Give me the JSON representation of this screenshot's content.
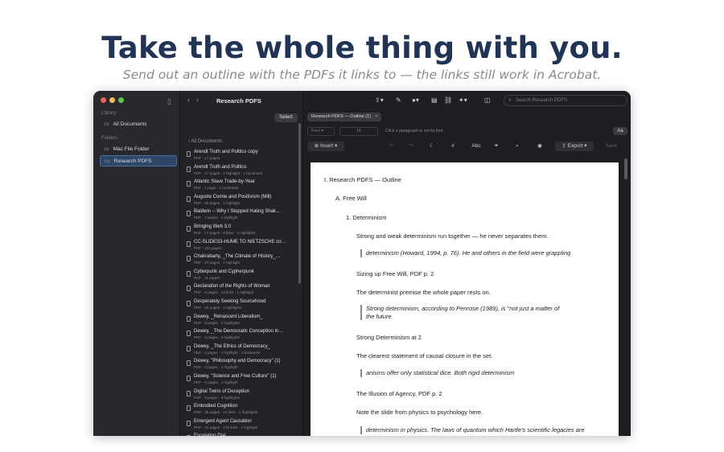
{
  "hero": {
    "title": "Take the whole thing with you.",
    "subtitle": "Send out an outline with the PDFs it links to — the links still work in Acrobat."
  },
  "colors": {
    "accent": "#2f4667",
    "hero_title": "#1f3457",
    "traffic_red": "#ee5f57",
    "traffic_yellow": "#f6be4f",
    "traffic_green": "#5fc650"
  },
  "sidebar": {
    "library_label": "Library",
    "all_documents": "All Documents",
    "folders_label": "Folders",
    "folders": [
      {
        "label": "Mac File Folder",
        "active": false
      },
      {
        "label": "Research PDFS",
        "active": true
      }
    ]
  },
  "list": {
    "title": "Research PDFS",
    "select_label": "Select",
    "back_label": "All Documents",
    "docs": [
      {
        "title": "Arendt Truth and Politics copy",
        "meta": "PDF · 17 pages"
      },
      {
        "title": "Arendt Truth and Politics",
        "meta": "PDF · 17 pages · 1 highlight · 1 bookmark"
      },
      {
        "title": "Atlantic Slave Trade-by-Year",
        "meta": "PDF · 1 page · 1 bookmark"
      },
      {
        "title": "Auguste Comte and Positivism (Mill)",
        "meta": "PDF · 65 pages · 1 highlight"
      },
      {
        "title": "Baldwin -- Why I Stopped Hating Shak…",
        "meta": "PDF · 7 pages · 1 highlight"
      },
      {
        "title": "Bringing Web 3.0",
        "meta": "PDF · 17 pages · 9 links · 2 highlights"
      },
      {
        "title": "CC-SLIDES3-HUME TO NIETZSCHE co…",
        "meta": "PDF · 115 pages"
      },
      {
        "title": "Chakrabarty, _The Climate of History_…",
        "meta": "PDF · 27 pages · 1 highlight"
      },
      {
        "title": "Cyberpunk and Cypherpunk",
        "meta": "PDF · 11 pages"
      },
      {
        "title": "Declaration of the Rights of Woman",
        "meta": "PDF · 8 pages · 13 links · 1 highlight"
      },
      {
        "title": "Desperately Seeking Sourcehood",
        "meta": "PDF · 24 pages · 2 highlights"
      },
      {
        "title": "Dewey, _Renascent Liberalism_",
        "meta": "PDF · 8 pages · 2 highlights"
      },
      {
        "title": "Dewey, _The Democratic Conception in…",
        "meta": "PDF · 6 pages · 2 highlights"
      },
      {
        "title": "Dewey, _The Ethics of Democracy_",
        "meta": "PDF · 4 pages · 1 highlight · 1 bookmark"
      },
      {
        "title": "Dewey, \"Philosophy and Democracy\" (1)",
        "meta": "PDF · 3 pages · 1 highlight"
      },
      {
        "title": "Dewey, \"Science and Free Culture\" (1)",
        "meta": "PDF · 6 pages · 1 highlight"
      },
      {
        "title": "Digital Twins of Deception",
        "meta": "PDF · 9 pages · 2 highlights"
      },
      {
        "title": "Embodied Cognition",
        "meta": "PDF · 35 pages · 13 links · 2 highlights"
      },
      {
        "title": "Emergent Agent Causation",
        "meta": "PDF · 24 pages · 175 links · 1 highlight"
      },
      {
        "title": "Escalation Dial",
        "meta": ""
      }
    ]
  },
  "toolbar": {
    "search_placeholder": "Search Research PDFS"
  },
  "editor": {
    "tab_label": "Research PDFS — Outline (1)",
    "font_placeholder": "Font",
    "font_size": "16",
    "font_hint": "Click a paragraph to set its font",
    "aa_label": "Aa",
    "insert_label": "Insert",
    "abc_label": "Abc",
    "export_label": "Export",
    "save_label": "Save",
    "outline": {
      "h1": "I.  Research PDFS — Outline",
      "h2": "A.  Free Will",
      "h3": "1.  Determinism",
      "p1": "Strong and weak determinism run together — he never separates them.",
      "q1": "determinism (Howard, 1994, p. 76). He and others in the field were grappling",
      "p2": "Sizing up Free Will, PDF p. 2",
      "p3": "The determinist premise the whole paper rests on.",
      "q2a": "Strong determinism, according to Penrose (1989), is \"not just a matter of",
      "q2b": "the future",
      "p4": "Strong Determinism at 2",
      "p5": "The clearest statement of causal closure in the set.",
      "q3": "anisms offer only statistical dice. Both rigid determinism",
      "p6": "The Illusion of Agency, PDF p. 2",
      "p7": "Note the slide from physics to psychology here.",
      "q4": "determinism in physics. The laws of quantum which Hartle's scientific legacies are"
    }
  }
}
